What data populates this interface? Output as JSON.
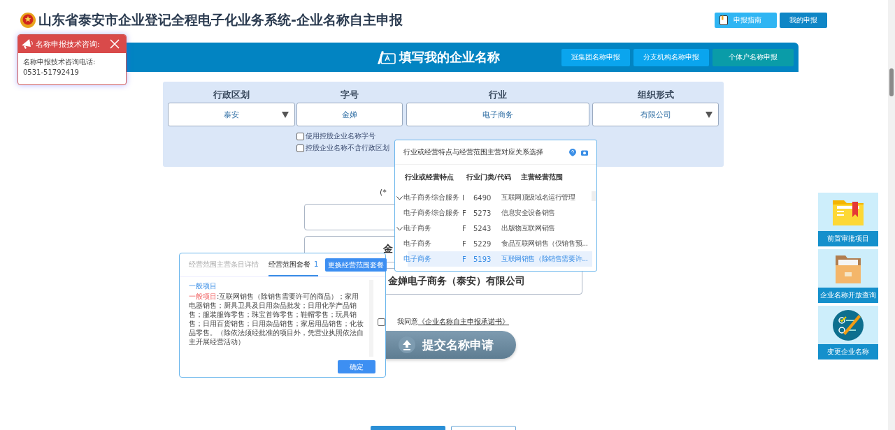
{
  "header": {
    "title": "山东省泰安市企业登记全程电子化业务系统-企业名称自主申报",
    "buttons": [
      {
        "label": "申报指南",
        "kind": "guide"
      },
      {
        "label": "我的申报",
        "kind": "mine"
      }
    ]
  },
  "consult_popup": {
    "title": "名称申报技术咨询:",
    "lines": [
      "名称申报技术咨询电话:",
      "0531-51792419"
    ]
  },
  "banner": {
    "title": "填写我的企业名称",
    "buttons": [
      {
        "label": "冠集团名称申报",
        "kind": "blue"
      },
      {
        "label": "分支机构名称申报",
        "kind": "blue"
      },
      {
        "label": "个体户名称申报",
        "kind": "teal"
      }
    ]
  },
  "form": {
    "fields": [
      {
        "label": "行政区划",
        "value": "泰安",
        "kind": "select"
      },
      {
        "label": "字号",
        "value": "金婵",
        "kind": "input"
      },
      {
        "label": "行业",
        "value": "电子商务",
        "kind": "input"
      },
      {
        "label": "组织形式",
        "value": "有限公司",
        "kind": "select"
      }
    ],
    "options": [
      {
        "label": "使用控股企业名称字号",
        "checked": false
      },
      {
        "label": "控股企业名称不含行政区划",
        "checked": false
      }
    ]
  },
  "hint": "(*",
  "name_boxes": [
    "金",
    "金婵电子商务（泰安）有限公司"
  ],
  "agreement": {
    "text": "我同意",
    "link": "《企业名称自主申报承诺书》"
  },
  "submit": "提交名称申请",
  "industry_popup": {
    "title": "行业或经营特点与经营范围主营对应关系选择",
    "columns": [
      "行业或经营特点",
      "行业门类/代码",
      "主营经营范围"
    ],
    "rows": [
      {
        "industry": "电子商务综合服务",
        "category": "I",
        "code": "6490",
        "scope": "互联网顶级域名运行管理",
        "expanded": true,
        "selected": false
      },
      {
        "industry": "电子商务综合服务",
        "category": "F",
        "code": "5273",
        "scope": "信息安全设备销售",
        "expanded": false,
        "selected": false
      },
      {
        "industry": "电子商务",
        "category": "F",
        "code": "5243",
        "scope": "出版物互联网销售",
        "expanded": true,
        "selected": false
      },
      {
        "industry": "电子商务",
        "category": "F",
        "code": "5229",
        "scope": "食品互联网销售（仅销售预...",
        "expanded": false,
        "selected": false
      },
      {
        "industry": "电子商务",
        "category": "F",
        "code": "5193",
        "scope": "互联网销售（除销售需要许...",
        "expanded": false,
        "selected": true
      }
    ]
  },
  "scope_popup": {
    "tabs": [
      {
        "label": "经营范围主营条目详情",
        "selected": false
      },
      {
        "label": "经营范围套餐",
        "count": "1",
        "selected": true
      }
    ],
    "change_button": "更换经营范围套餐",
    "heading": "一般项目",
    "prefix": "一般项目",
    "text": ":互联网销售（除销售需要许可的商品）；家用电器销售；厨具卫具及日用杂品批发；日用化学产品销售；服装服饰零售；珠宝首饰零售；鞋帽零售；玩具销售；日用百货销售；日用杂品销售；家居用品销售；化妆品零售。（除依法须经批准的项目外，凭营业执照依法自主开展经营活动）",
    "checked": false,
    "ok_button": "确定"
  },
  "side_tiles": [
    {
      "label": "前置审批项目",
      "kind": "folder"
    },
    {
      "label": "企业名称开放查询",
      "kind": "files"
    },
    {
      "label": "变更企业名称",
      "kind": "checklist"
    }
  ]
}
